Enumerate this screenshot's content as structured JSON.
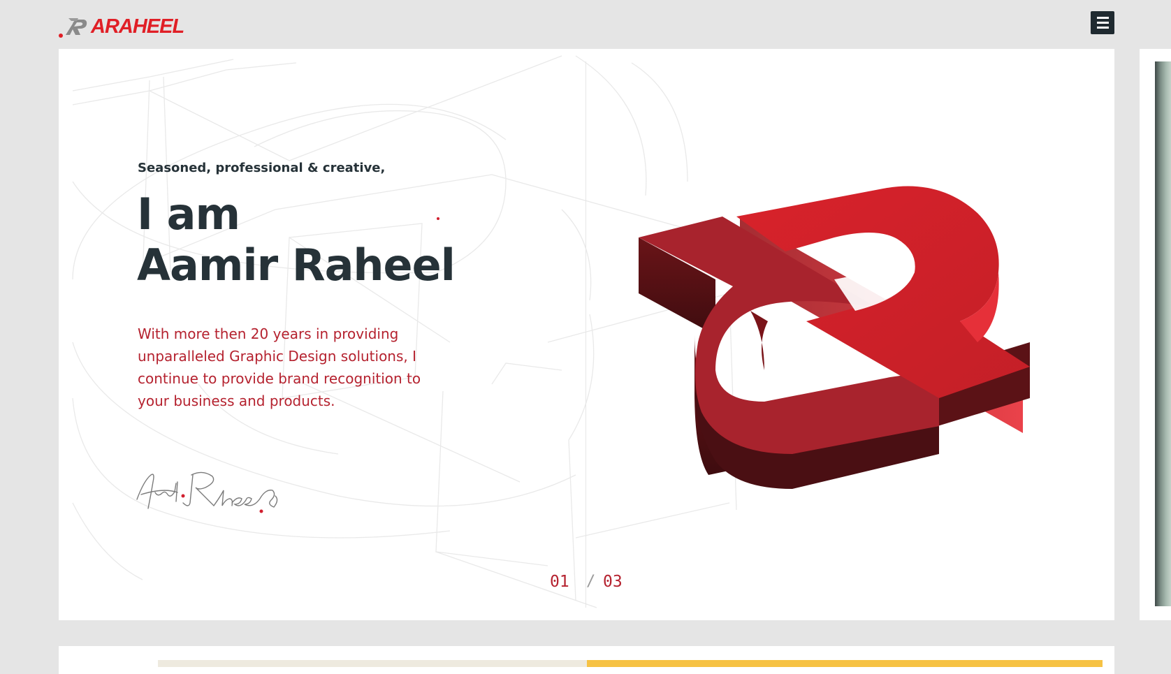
{
  "header": {
    "logo_text": "ARAHEEL",
    "menu_icon": "hamburger-menu-icon"
  },
  "hero": {
    "eyebrow": "Seasoned, professional & creative,",
    "headline_line1": "I am",
    "headline_line2": "Aamir Raheel",
    "intro": "With more then 20 years in providing unparalleled Graphic Design solutions, I continue to provide brand recognition to your business and products.",
    "signature_icon": "signature-image",
    "brand_mark_icon": "3d-logo-mark"
  },
  "slider": {
    "current": "01",
    "separator": "/",
    "total": "03"
  },
  "colors": {
    "brand_red": "#e01f26",
    "text_dark": "#263238",
    "intro_red": "#b5222f",
    "background": "#e5e5e5"
  }
}
